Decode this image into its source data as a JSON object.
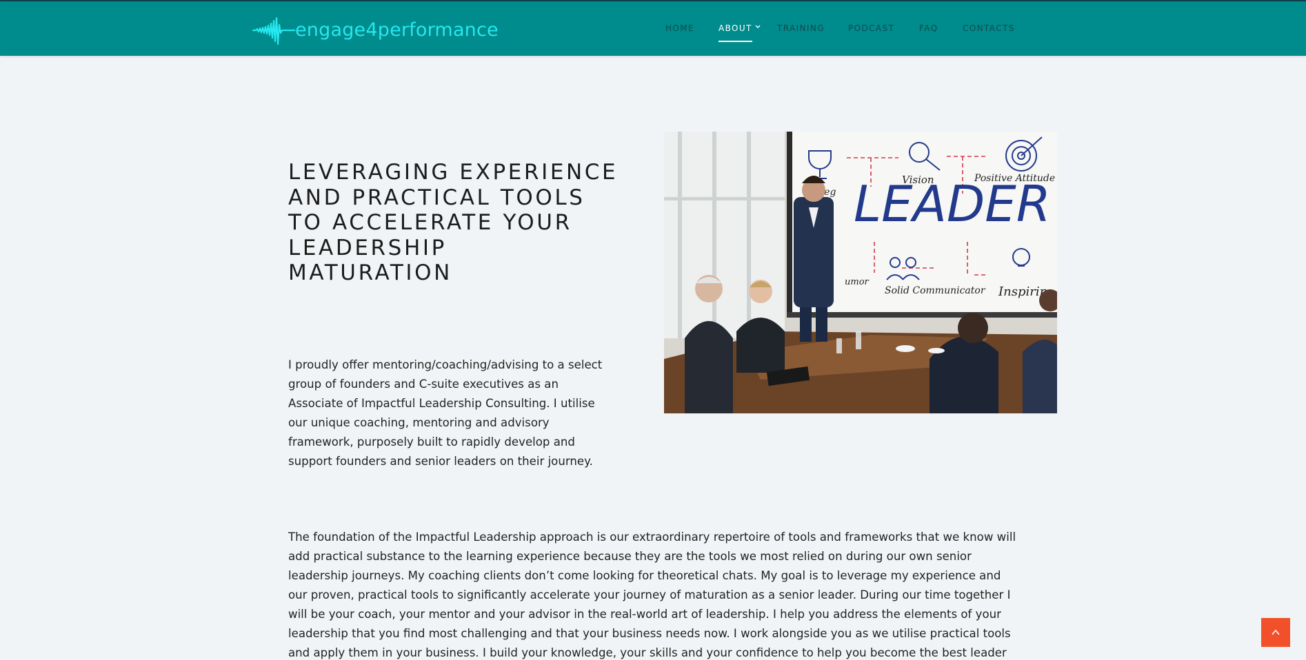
{
  "brand": {
    "name": "engage4performance"
  },
  "nav": {
    "items": [
      {
        "label": "HOME"
      },
      {
        "label": "ABOUT"
      },
      {
        "label": "TRAINING"
      },
      {
        "label": "PODCAST"
      },
      {
        "label": "FAQ"
      },
      {
        "label": "CONTACTS"
      }
    ],
    "active": "ABOUT"
  },
  "hero": {
    "title": "LEVERAGING EXPERIENCE AND PRACTICAL TOOLS TO ACCELERATE YOUR LEADERSHIP MATURATION",
    "intro": "I proudly offer mentoring/coaching/advising to a select group of founders and C-suite executives as an Associate of Impactful Leadership Consulting. I utilise our unique coaching, mentoring and advisory framework, purposely built to rapidly develop and support founders and senior leaders on their journey."
  },
  "photo": {
    "board_words": [
      "LEADER",
      "Vision",
      "Positive Attitude",
      "Solid Communicator",
      "Inspirin",
      "Integ",
      "umor"
    ]
  },
  "body": {
    "paragraph": "The foundation of the Impactful Leadership approach is our extraordinary repertoire of tools and frameworks that we know will add practical substance to the learning experience because they are the tools we most relied on during our own senior leadership journeys. My coaching clients don’t come looking for theoretical chats. My goal is to leverage my experience and our proven, practical tools to significantly accelerate your journey of maturation as a senior leader. During our time together I will be your coach, your mentor and your advisor in the real-world art of leadership. I help you address the elements of your leadership that you find most challenging and that your business needs now. I work alongside you as we utilise practical tools and apply them in your business. I build your knowledge, your skills and your confidence to help you become the best leader"
  },
  "colors": {
    "header": "#008b8c",
    "logo": "#25e8ef",
    "nav_text": "#13494e",
    "nav_active": "#ffffff",
    "to_top_button": "#f2502a",
    "page_bg": "#f1f4f6"
  },
  "icons": {
    "nav_dropdown": "chevron-down-icon",
    "back_to_top": "chevron-up-icon"
  }
}
